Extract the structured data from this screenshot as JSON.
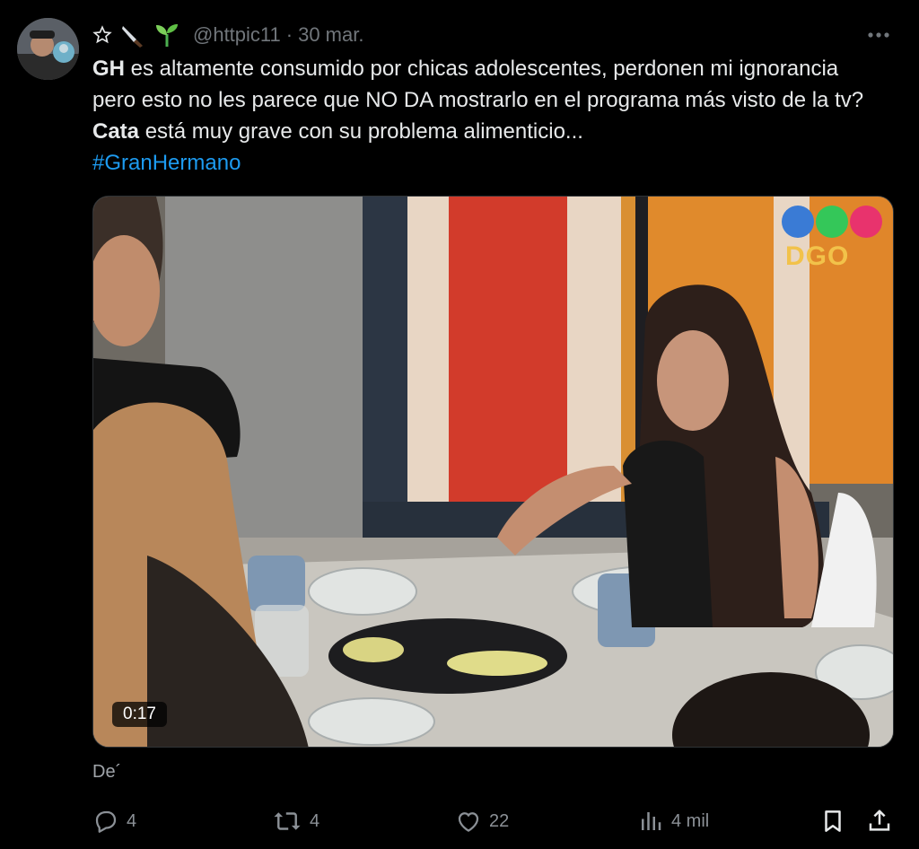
{
  "tweet": {
    "author_emojis": [
      "star-outline",
      "knife",
      "seedling"
    ],
    "handle": "@httpic11",
    "separator": "·",
    "date": "30 mar.",
    "text": {
      "p1_bold": "GH",
      "p1_rest": " es altamente consumido por chicas adolescentes, perdonen mi ignorancia pero esto no les parece que NO DA mostrarlo en el programa más visto de la tv? ",
      "p2_bold": "Cata",
      "p2_rest": " está muy grave con su problema alimenticio...",
      "hashtag": "#GranHermano"
    },
    "media": {
      "duration": "0:17",
      "channel_logo_text": "DGO",
      "channel_logo_colors": [
        "#3a7bd5",
        "#34c759",
        "#e8336d"
      ]
    },
    "translate_label": "De´",
    "actions": {
      "replies": "4",
      "retweets": "4",
      "likes": "22",
      "views": "4 mil"
    }
  },
  "colors": {
    "background": "#000000",
    "text": "#e7e9ea",
    "muted": "#71767b",
    "link": "#1d9bf0"
  }
}
